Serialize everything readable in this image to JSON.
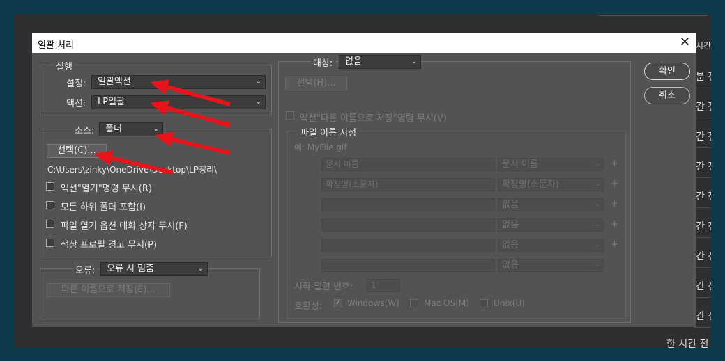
{
  "background": {
    "right_labels": [
      "분 전",
      "간 전",
      "간 전",
      "간 전",
      "간 전",
      "간 전",
      "간 전",
      "간 전",
      "간 전"
    ],
    "top_label": "시간",
    "bottom_label": "한 시간 전"
  },
  "dialog": {
    "title": "일괄 처리",
    "close_glyph": "✕"
  },
  "play": {
    "legend": "실행",
    "set_label": "설정:",
    "set_value": "일괄액션",
    "action_label": "액션:",
    "action_value": "LP일괄"
  },
  "source": {
    "label": "소스:",
    "value": "폴더",
    "choose_button": "선택(C)...",
    "path": "C:\\Users\\zinky\\OneDrive\\Desktop\\LP정리\\",
    "options": [
      "액션\"열기\"명령 무시(R)",
      "모든 하위 폴더 포함(I)",
      "파일 열기 옵션 대화 상자 무시(F)",
      "색상 프로필 경고 무시(P)"
    ]
  },
  "errors": {
    "label": "오류:",
    "value": "오류 시 멈춤",
    "save_as_button": "다른 이름으로 저장(E)..."
  },
  "destination": {
    "label": "대상:",
    "value": "없음",
    "choose_button": "선택(H)...",
    "override_label": "액션\"다른 이름으로 저장\"명령 무시(V)"
  },
  "naming": {
    "legend": "파일 이름 지정",
    "example": "예: MyFile.gif",
    "rows": [
      {
        "field": "문서 이름",
        "select": "문서 이름"
      },
      {
        "field": "확장명(소문자)",
        "select": "확장명(소문자)"
      },
      {
        "field": "",
        "select": "없음"
      },
      {
        "field": "",
        "select": "없음"
      },
      {
        "field": "",
        "select": "없음"
      },
      {
        "field": "",
        "select": "없음"
      }
    ],
    "serial_label": "시작 일련 번호:",
    "serial_value": "1",
    "compat_label": "호환성:",
    "compat_windows": "Windows(W)",
    "compat_mac": "Mac OS(M)",
    "compat_unix": "Unix(U)",
    "plus_glyph": "+"
  },
  "buttons": {
    "ok": "확인",
    "cancel": "취소"
  },
  "icons": {
    "chevron": "chevron-down-icon",
    "check": "checkmark-icon",
    "arrow": "red-annotation-arrow"
  },
  "colors": {
    "dialog_bg": "#535353",
    "arrow": "#e8131b"
  }
}
